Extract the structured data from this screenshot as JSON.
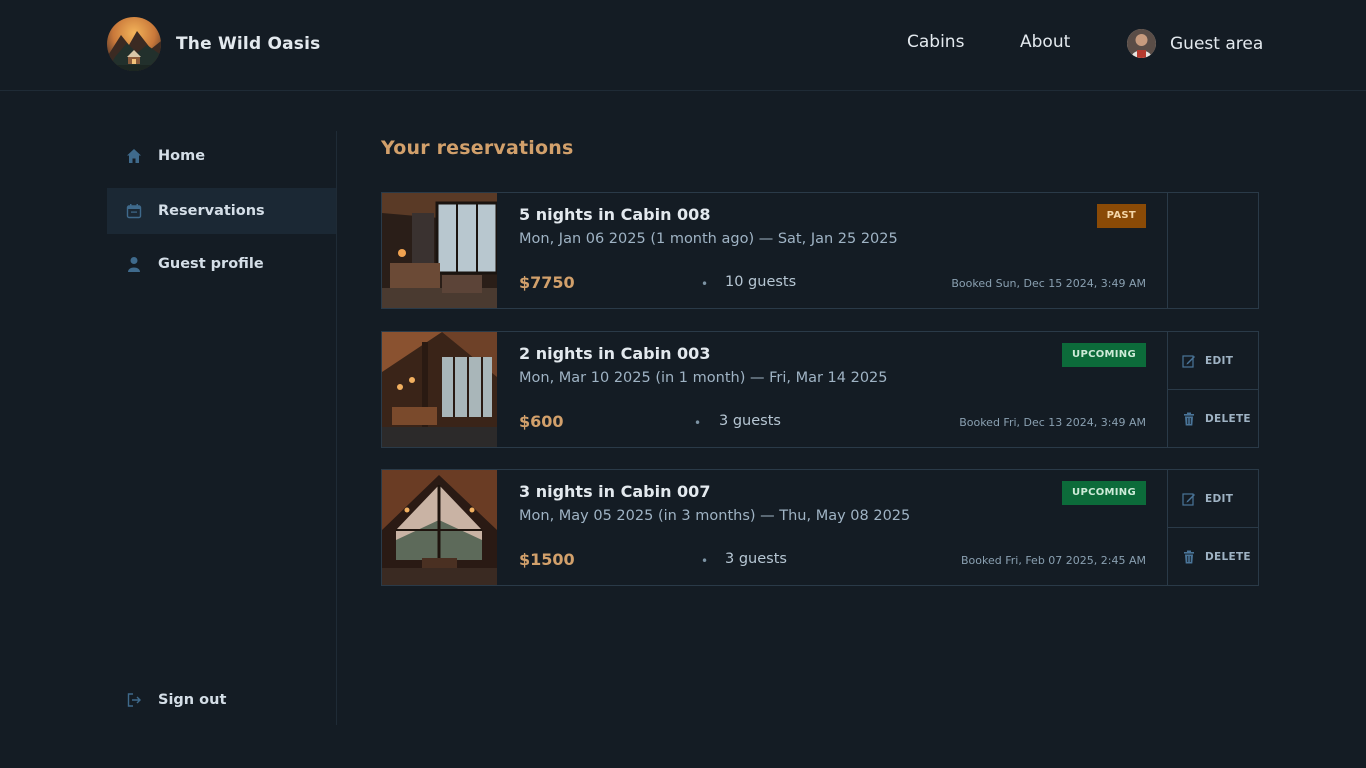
{
  "header": {
    "brand": "The Wild Oasis",
    "logo_icon": "mountain-cabin-logo",
    "nav": {
      "cabins": "Cabins",
      "about": "About",
      "guest_area": "Guest area"
    }
  },
  "sidebar": {
    "items": [
      {
        "label": "Home",
        "icon": "home-icon"
      },
      {
        "label": "Reservations",
        "icon": "calendar-icon",
        "active": true
      },
      {
        "label": "Guest profile",
        "icon": "user-icon"
      }
    ],
    "sign_out": "Sign out"
  },
  "main": {
    "title": "Your reservations",
    "reservations": [
      {
        "title": "5 nights in Cabin 008",
        "dates": "Mon, Jan 06 2025 (1 month ago) — Sat, Jan 25 2025",
        "price": "$7750",
        "guests": "10 guests",
        "booked": "Booked Sun, Dec 15 2024, 3:49 AM",
        "status": "PAST"
      },
      {
        "title": "2 nights in Cabin 003",
        "dates": "Mon, Mar 10 2025 (in 1 month) — Fri, Mar 14 2025",
        "price": "$600",
        "guests": "3 guests",
        "booked": "Booked Fri, Dec 13 2024, 3:49 AM",
        "status": "UPCOMING"
      },
      {
        "title": "3 nights in Cabin 007",
        "dates": "Mon, May 05 2025 (in 3 months) — Thu, May 08 2025",
        "price": "$1500",
        "guests": "3 guests",
        "booked": "Booked Fri, Feb 07 2025, 2:45 AM",
        "status": "UPCOMING"
      }
    ],
    "actions": {
      "edit": "EDIT",
      "delete": "DELETE"
    }
  },
  "colors": {
    "background": "#141c24",
    "accent": "#d2a06b",
    "past_badge": "#8a4a06",
    "upcoming_badge": "#0c6b3a"
  }
}
